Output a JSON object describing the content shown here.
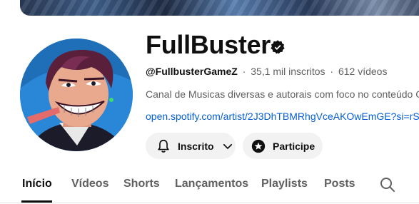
{
  "channel": {
    "name": "FullBuster",
    "handle": "@FullbusterGameZ",
    "separator": "·",
    "subscribers": "35,1 mil inscritos",
    "videos": "612 vídeos",
    "description": "Canal de Musicas diversas e autorais com foco no conteúdo G",
    "link": "open.spotify.com/artist/2J3DhTBMRhgVceAKOwEmGE?si=rS"
  },
  "buttons": {
    "subscribed_label": "Inscrito",
    "join_label": "Participe"
  },
  "tabs": [
    {
      "label": "Início",
      "active": true
    },
    {
      "label": "Vídeos",
      "active": false
    },
    {
      "label": "Shorts",
      "active": false
    },
    {
      "label": "Lançamentos",
      "active": false
    },
    {
      "label": "Playlists",
      "active": false
    },
    {
      "label": "Posts",
      "active": false
    }
  ],
  "icons": {
    "verified": "verified-badge-icon",
    "bell": "bell-icon",
    "chevron": "chevron-down-icon",
    "join": "star-badge-icon",
    "search": "search-icon"
  },
  "colors": {
    "link": "#065fd4",
    "button_bg": "#f2f2f2",
    "text_primary": "#0f0f0f",
    "text_secondary": "#606060"
  }
}
